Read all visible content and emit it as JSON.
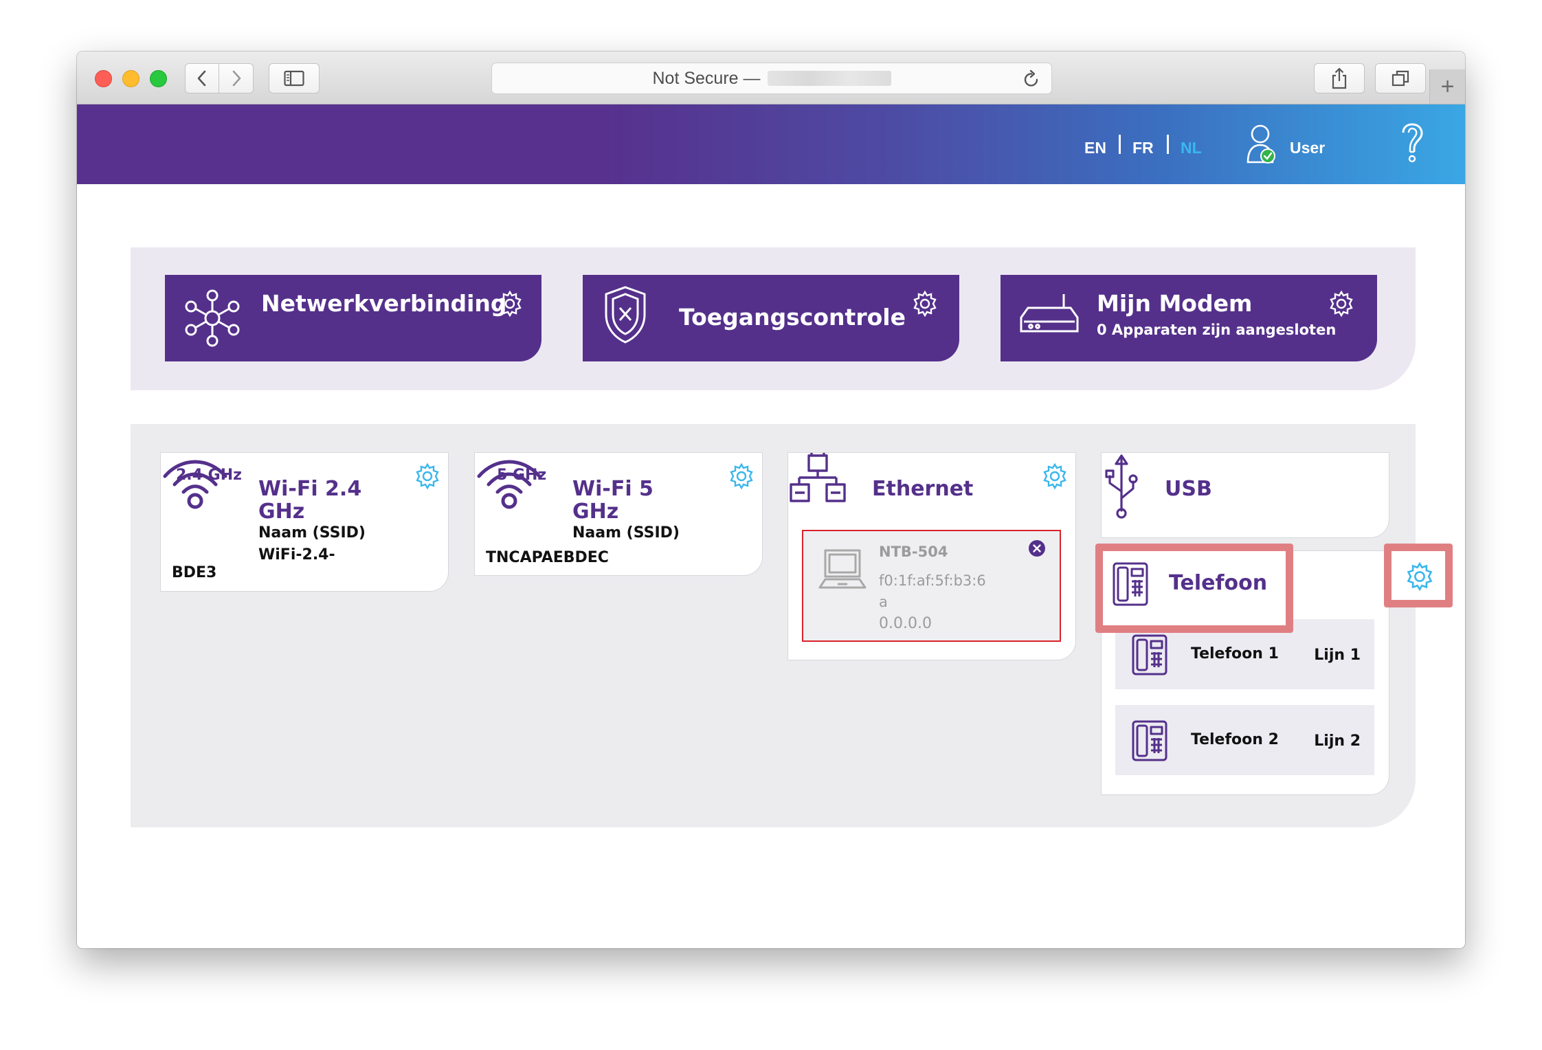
{
  "browser": {
    "address_text": "Not Secure —",
    "new_tab_symbol": "+"
  },
  "header": {
    "languages": [
      "EN",
      "FR",
      "NL"
    ],
    "active_language": "NL",
    "user_label": "User",
    "help_icon": "question-mark-icon"
  },
  "tiles": [
    {
      "title": "Netwerkverbinding",
      "subtitle": "",
      "icon": "network-nodes-icon"
    },
    {
      "title": "Toegangscontrole",
      "subtitle": "",
      "icon": "shield-x-icon"
    },
    {
      "title": "Mijn Modem",
      "subtitle": "0 Apparaten zijn aangesloten",
      "icon": "modem-icon"
    }
  ],
  "cards": {
    "wifi24": {
      "band": "2.4 GHz",
      "title_line1": "Wi-Fi 2.4",
      "title_line2": "GHz",
      "ssid_label": "Naam (SSID)",
      "ssid_line1": "WiFi-2.4-",
      "ssid_line2": "BDE3"
    },
    "wifi5": {
      "band": "5 GHz",
      "title_line1": "Wi-Fi 5",
      "title_line2": "GHz",
      "ssid_label": "Naam (SSID)",
      "ssid_value": "TNCAPAEBDEC"
    },
    "ethernet": {
      "title": "Ethernet",
      "device_name": "NTB-504",
      "device_mac_line1": "f0:1f:af:5f:b3:6",
      "device_mac_line2": "a",
      "device_ip": "0.0.0.0"
    },
    "usb": {
      "title": "USB"
    },
    "telefoon": {
      "title": "Telefoon",
      "phones": [
        {
          "name": "Telefoon 1",
          "line": "Lijn 1"
        },
        {
          "name": "Telefoon 2",
          "line": "Lijn 2"
        }
      ]
    }
  },
  "colors": {
    "brand_purple": "#54308b",
    "accent_blue": "#3ab7ec",
    "highlight": "#e07f82",
    "error_red": "#d9222b"
  }
}
